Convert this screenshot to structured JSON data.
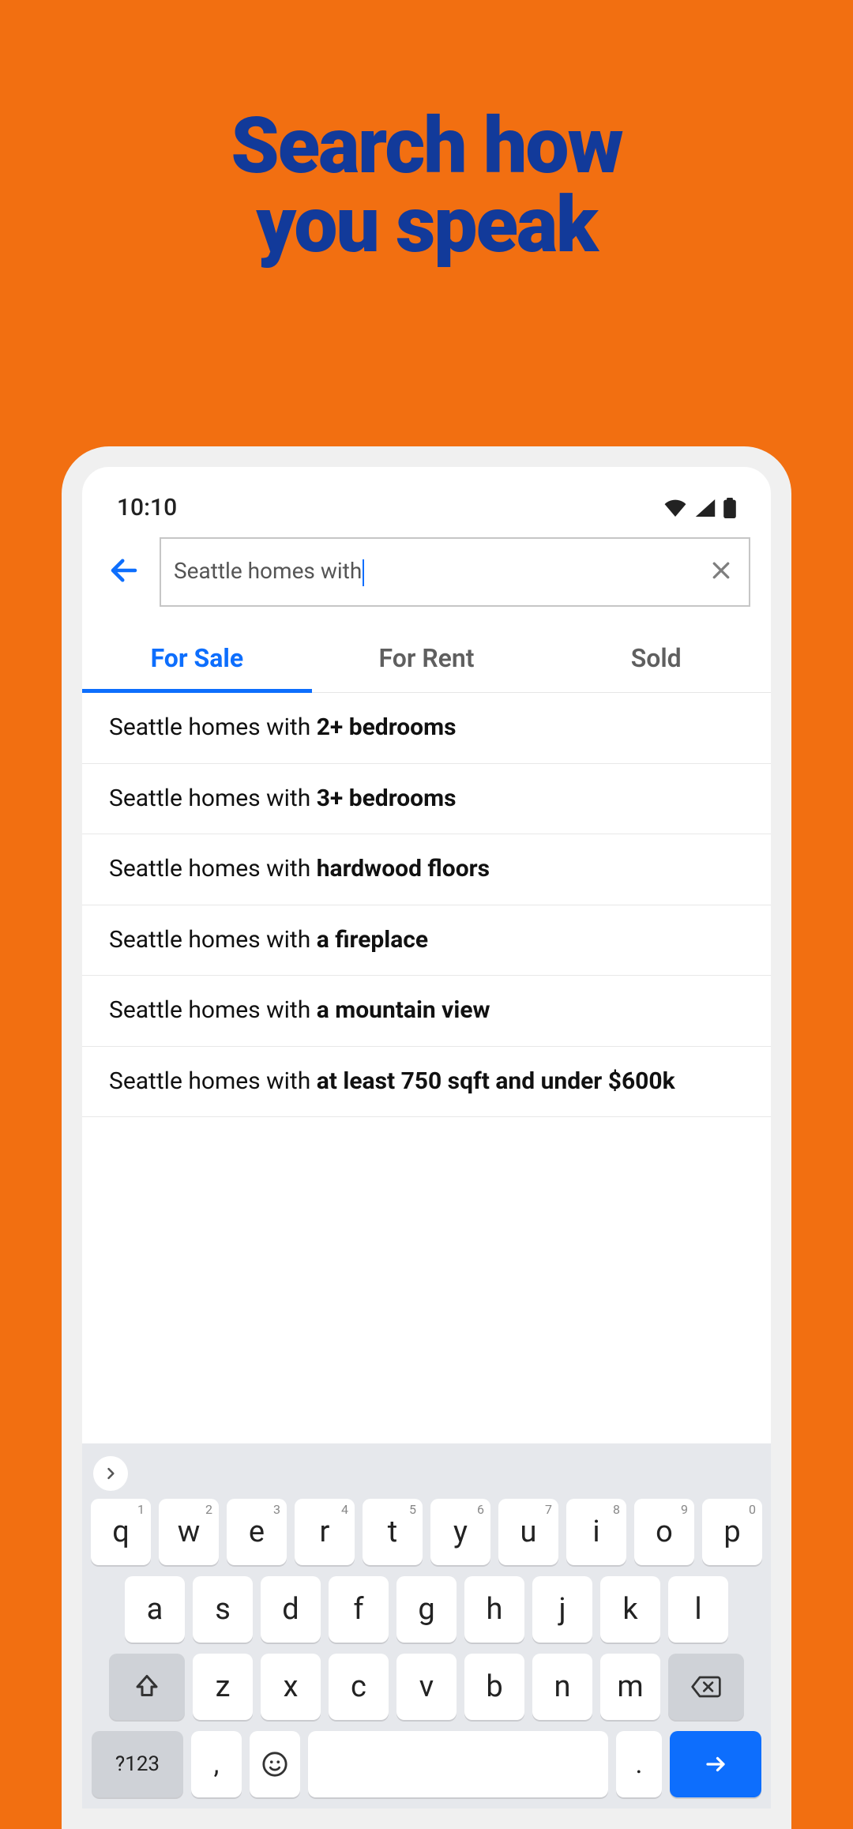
{
  "headline_line1": "Search how",
  "headline_line2": "you speak",
  "statusbar": {
    "time": "10:10"
  },
  "search": {
    "value": "Seattle homes with"
  },
  "tabs": [
    {
      "label": "For Sale",
      "active": true
    },
    {
      "label": "For Rent",
      "active": false
    },
    {
      "label": "Sold",
      "active": false
    }
  ],
  "suggestions": [
    {
      "prefix": "Seattle homes with ",
      "bold": "2+ bedrooms"
    },
    {
      "prefix": "Seattle homes with ",
      "bold": "3+ bedrooms"
    },
    {
      "prefix": "Seattle homes with ",
      "bold": "hardwood floors"
    },
    {
      "prefix": "Seattle homes with ",
      "bold": "a fireplace"
    },
    {
      "prefix": "Seattle homes with ",
      "bold": "a mountain view"
    },
    {
      "prefix": "Seattle homes with ",
      "bold": "at least 750 sqft and under $600k"
    }
  ],
  "keyboard": {
    "row1": [
      {
        "main": "q",
        "sub": "1"
      },
      {
        "main": "w",
        "sub": "2"
      },
      {
        "main": "e",
        "sub": "3"
      },
      {
        "main": "r",
        "sub": "4"
      },
      {
        "main": "t",
        "sub": "5"
      },
      {
        "main": "y",
        "sub": "6"
      },
      {
        "main": "u",
        "sub": "7"
      },
      {
        "main": "i",
        "sub": "8"
      },
      {
        "main": "o",
        "sub": "9"
      },
      {
        "main": "p",
        "sub": "0"
      }
    ],
    "row2": [
      "a",
      "s",
      "d",
      "f",
      "g",
      "h",
      "j",
      "k",
      "l"
    ],
    "row3": [
      "z",
      "x",
      "c",
      "v",
      "b",
      "n",
      "m"
    ],
    "sym": "?123",
    "comma": ",",
    "period": "."
  }
}
